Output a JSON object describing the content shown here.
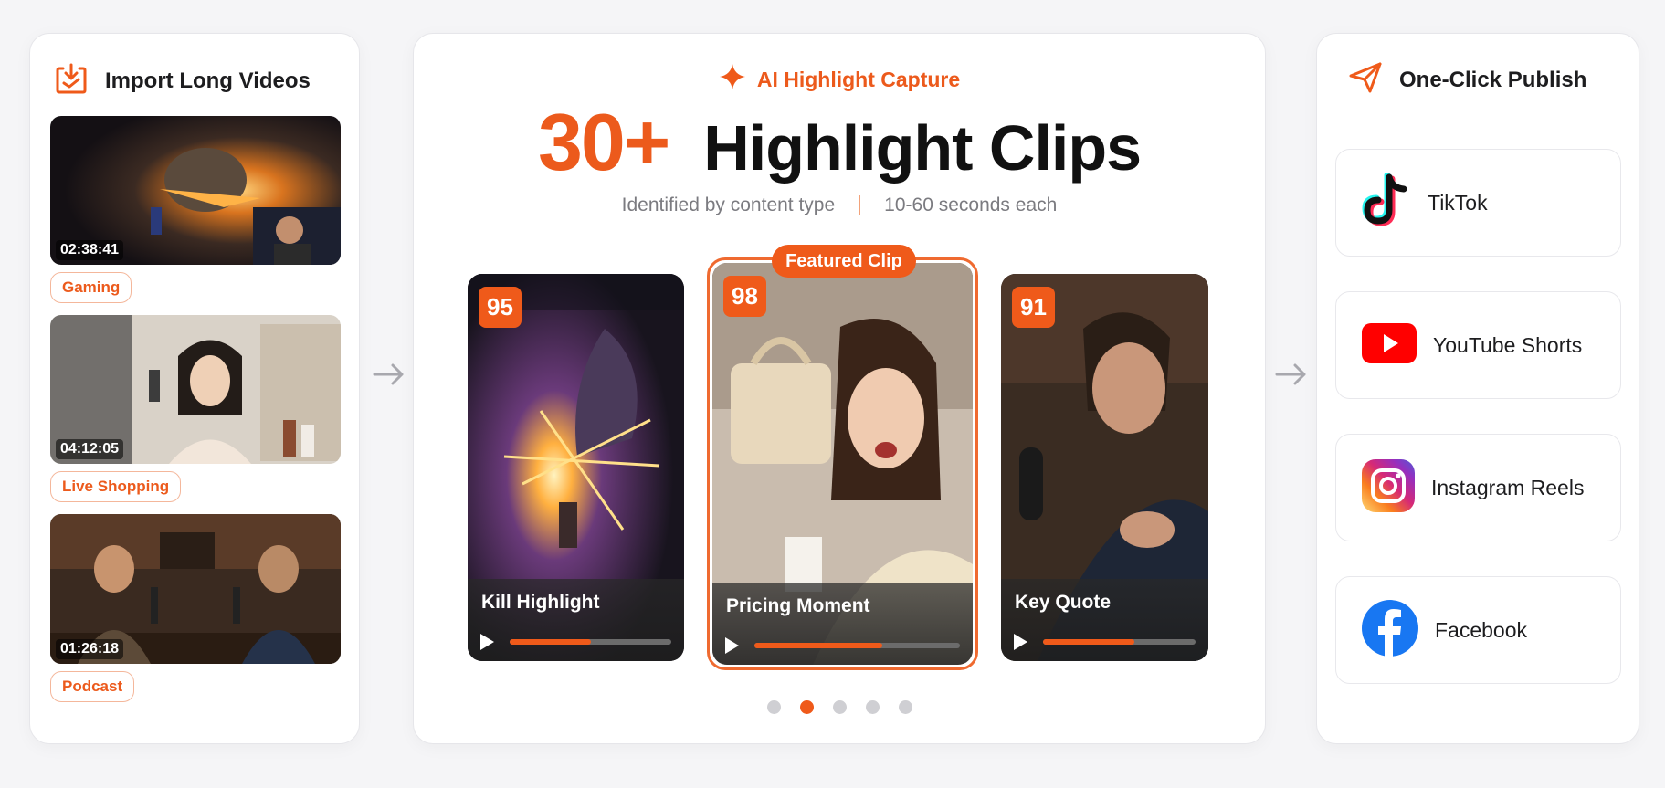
{
  "import_panel": {
    "title": "Import Long Videos",
    "videos": [
      {
        "duration": "02:38:41",
        "category": "Gaming"
      },
      {
        "duration": "04:12:05",
        "category": "Live Shopping"
      },
      {
        "duration": "01:26:18",
        "category": "Podcast"
      }
    ]
  },
  "capture_panel": {
    "eyebrow": "AI Highlight Capture",
    "headline_number": "30+",
    "headline_text": "Highlight Clips",
    "subtitle_left": "Identified by content type",
    "subtitle_right": "10-60 seconds each",
    "featured_badge": "Featured Clip",
    "clips": [
      {
        "score": "95",
        "label": "Kill Highlight",
        "progress": 0.5
      },
      {
        "score": "98",
        "label": "Pricing Moment",
        "progress": 0.62
      },
      {
        "score": "91",
        "label": "Key Quote",
        "progress": 0.6
      }
    ],
    "pagination": {
      "count": 5,
      "active_index": 1
    }
  },
  "publish_panel": {
    "title": "One-Click Publish",
    "platforms": [
      {
        "name": "TikTok",
        "icon": "tiktok-icon"
      },
      {
        "name": "YouTube Shorts",
        "icon": "youtube-icon"
      },
      {
        "name": "Instagram Reels",
        "icon": "instagram-icon"
      },
      {
        "name": "Facebook",
        "icon": "facebook-icon"
      }
    ]
  },
  "colors": {
    "accent": "#ef5a1a",
    "background": "#f5f5f7",
    "tag_border": "#f4b79b"
  }
}
